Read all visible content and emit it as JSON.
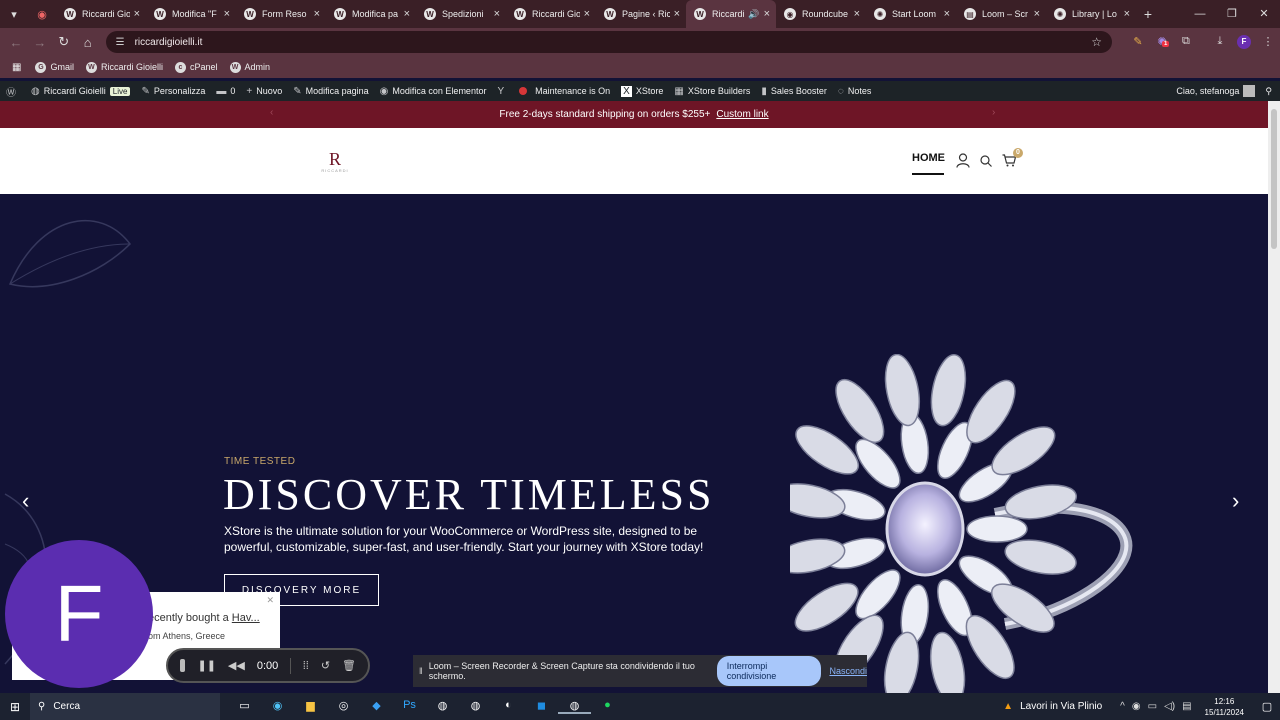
{
  "browser": {
    "tabs": [
      {
        "title": "Riccardi Gio",
        "icon": "W",
        "active": false
      },
      {
        "title": "Modifica \"F",
        "icon": "W",
        "active": false
      },
      {
        "title": "Form Reso",
        "icon": "W",
        "active": false
      },
      {
        "title": "Modifica pa",
        "icon": "W",
        "active": false
      },
      {
        "title": "Spedizioni",
        "icon": "W",
        "active": false
      },
      {
        "title": "Riccardi Gio",
        "icon": "W",
        "active": false
      },
      {
        "title": "Pagine ‹ Ric",
        "icon": "W",
        "active": false
      },
      {
        "title": "Riccardi",
        "icon": "W",
        "active": true,
        "audio": true
      },
      {
        "title": "Roundcube",
        "icon": "◉",
        "active": false
      },
      {
        "title": "Start Loom",
        "icon": "✺",
        "active": false
      },
      {
        "title": "Loom – Scr",
        "icon": "▤",
        "active": false
      },
      {
        "title": "Library | Lo",
        "icon": "✺",
        "active": false
      }
    ],
    "url": "riccardigioielli.it",
    "bookmarks": [
      {
        "label": "Gmail",
        "icon": "G"
      },
      {
        "label": "Riccardi Gioielli",
        "icon": "W"
      },
      {
        "label": "cPanel",
        "icon": "c"
      },
      {
        "label": "Admin",
        "icon": "W"
      }
    ],
    "extension_badge": "1",
    "profile_initial": "F"
  },
  "wp_admin_bar": {
    "site_name": "Riccardi Gioielli",
    "live_badge": "Live",
    "customize": "Personalizza",
    "comments_count": "0",
    "new": "Nuovo",
    "edit_page": "Modifica pagina",
    "edit_elementor": "Modifica con Elementor",
    "maintenance": "Maintenance is On",
    "xstore": "XStore",
    "xstore_builders": "XStore Builders",
    "sales_booster": "Sales Booster",
    "notes": "Notes",
    "greeting": "Ciao, stefanoga"
  },
  "promo_bar": {
    "text": "Free 2-days standard shipping on orders $255+",
    "link": "Custom link"
  },
  "site_header": {
    "logo_letter": "R",
    "logo_text": "RICCARDI",
    "nav_home": "HOME",
    "cart_count": "0"
  },
  "hero": {
    "tagline": "TIME TESTED",
    "headline": "DISCOVER TIMELESS",
    "description": "XStore is the ultimate solution for your WooCommerce or WordPress site, designed to be powerful, customizable, super-fast, and user-friendly. Start your journey with XStore today!",
    "cta": "DISCOVERY MORE"
  },
  "sales_popup": {
    "line1_prefix": "ecently bought a",
    "line1_product": "Hav...",
    "line2": "om Athens, Greece"
  },
  "loom": {
    "avatar_initial": "F",
    "timer": "0:00",
    "share_text": "Loom – Screen Recorder & Screen Capture sta condividendo il tuo schermo.",
    "stop_sharing": "Interrompi condivisione",
    "hide": "Nascondi"
  },
  "taskbar": {
    "search": "Cerca",
    "news": "Lavori in Via Plinio",
    "time": "12:16",
    "date": "15/11/2024"
  }
}
